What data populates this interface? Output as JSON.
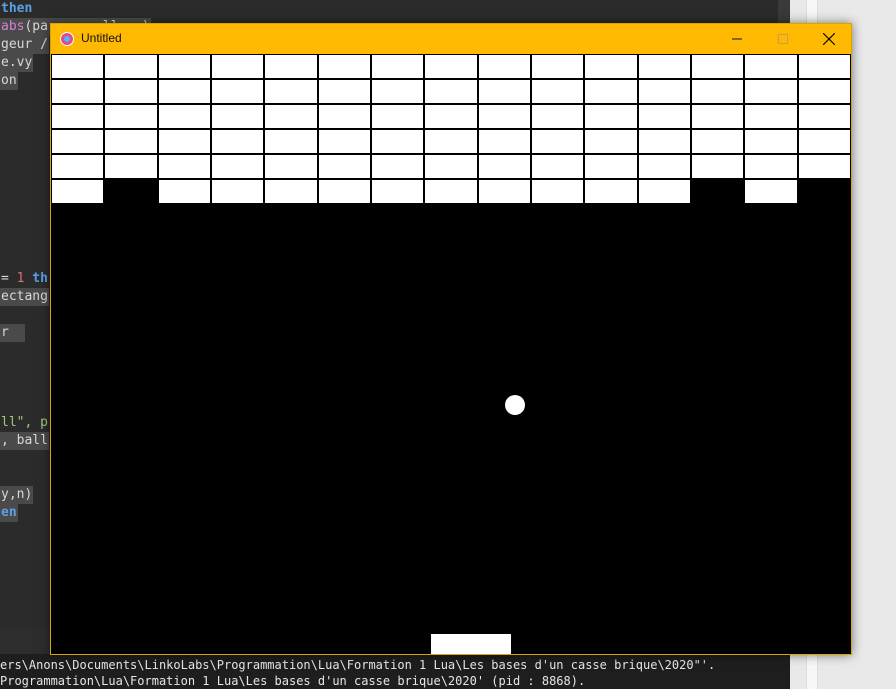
{
  "editor": {
    "lines": [
      {
        "parts": [
          {
            "t": "then",
            "c": "kw"
          }
        ],
        "hl": false
      },
      {
        "parts": [
          {
            "t": "abs",
            "c": "fn"
          },
          {
            "t": "(pa",
            "c": ""
          },
          {
            "t": "       ",
            "c": ""
          },
          {
            "t": "ll.",
            "c": ""
          },
          {
            "t": "  )",
            "c": ""
          }
        ],
        "hl": true
      },
      {
        "parts": [
          {
            "t": "geur /",
            "c": ""
          }
        ],
        "hl": true
      },
      {
        "parts": [
          {
            "t": "e.vy",
            "c": ""
          }
        ],
        "hl": true
      },
      {
        "parts": [
          {
            "t": "on",
            "c": ""
          }
        ],
        "hl": true
      },
      {
        "parts": [
          {
            "t": "= ",
            "c": ""
          },
          {
            "t": "1",
            "c": "num"
          },
          {
            "t": " th",
            "c": "kw"
          }
        ],
        "hl": false
      },
      {
        "parts": [
          {
            "t": "ectang",
            "c": ""
          }
        ],
        "hl": true
      },
      {
        "parts": [
          {
            "t": "r  ",
            "c": ""
          }
        ],
        "hl": true
      },
      {
        "parts": [
          {
            "t": "ll\", p",
            "c": "str"
          }
        ],
        "hl": false
      },
      {
        "parts": [
          {
            "t": ", ball",
            "c": ""
          }
        ],
        "hl": true
      },
      {
        "parts": [
          {
            "t": "y,n)",
            "c": ""
          }
        ],
        "hl": true
      },
      {
        "parts": [
          {
            "t": "en",
            "c": "kw"
          }
        ],
        "hl": true
      }
    ]
  },
  "console": {
    "lines": [
      "ers\\Anons\\Documents\\LinkoLabs\\Programmation\\Lua\\Formation 1 Lua\\Les bases d'un casse brique\\2020\"'.",
      "Programmation\\Lua\\Formation 1 Lua\\Les bases d'un casse brique\\2020' (pid : 8868)."
    ]
  },
  "window": {
    "title": "Untitled",
    "minimize_icon": "minimize-icon",
    "maximize_icon": "maximize-icon",
    "close_icon": "close-icon",
    "accent_color": "#ffb900"
  },
  "game": {
    "background_color": "#000000",
    "brick_color": "#ffffff",
    "brick_columns": 15,
    "brick_rows": 6,
    "bricks": [
      [
        1,
        1,
        1,
        1,
        1,
        1,
        1,
        1,
        1,
        1,
        1,
        1,
        1,
        1,
        1
      ],
      [
        1,
        1,
        1,
        1,
        1,
        1,
        1,
        1,
        1,
        1,
        1,
        1,
        1,
        1,
        1
      ],
      [
        1,
        1,
        1,
        1,
        1,
        1,
        1,
        1,
        1,
        1,
        1,
        1,
        1,
        1,
        1
      ],
      [
        1,
        1,
        1,
        1,
        1,
        1,
        1,
        1,
        1,
        1,
        1,
        1,
        1,
        1,
        1
      ],
      [
        1,
        1,
        1,
        1,
        1,
        1,
        1,
        1,
        1,
        1,
        1,
        1,
        1,
        1,
        1
      ],
      [
        1,
        0,
        1,
        1,
        1,
        1,
        1,
        1,
        1,
        1,
        1,
        1,
        0,
        1,
        0
      ]
    ]
  }
}
